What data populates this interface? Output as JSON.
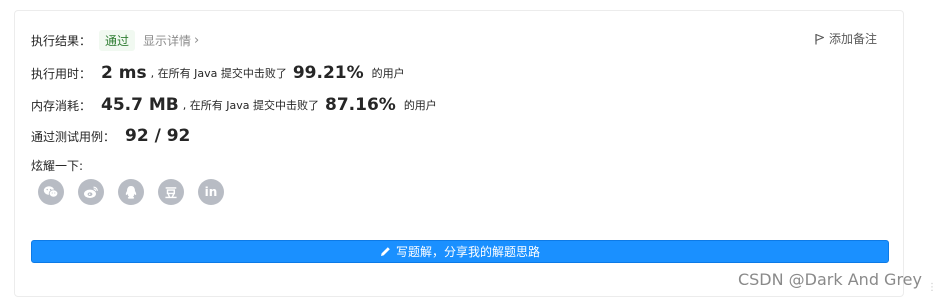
{
  "result": {
    "label": "执行结果：",
    "status": "通过",
    "details_link": "显示详情",
    "details_chevron": "›",
    "add_note": "添加备注"
  },
  "runtime": {
    "label": "执行用时：",
    "value": "2 ms",
    "prefix_text": ", 在所有 Java 提交中击败了",
    "percent": "99.21%",
    "suffix_text": "的用户"
  },
  "memory": {
    "label": "内存消耗：",
    "value": "45.7 MB",
    "prefix_text": ", 在所有 Java 提交中击败了",
    "percent": "87.16%",
    "suffix_text": "的用户"
  },
  "tests": {
    "label": "通过测试用例：",
    "value": "92 / 92"
  },
  "share": {
    "label": "炫耀一下:",
    "icons": [
      "wechat-icon",
      "weibo-icon",
      "qq-icon",
      "douban-icon",
      "linkedin-icon"
    ],
    "douban_glyph": "豆",
    "linkedin_glyph": "in"
  },
  "write_button": {
    "label": "写题解，分享我的解题思路"
  },
  "watermark": "CSDN @Dark And Grey",
  "colors": {
    "accent": "#1a90ff",
    "pass_bg": "#f1f9f1",
    "pass_text": "#2e7d32",
    "icon_grey": "#b8bcc4"
  }
}
